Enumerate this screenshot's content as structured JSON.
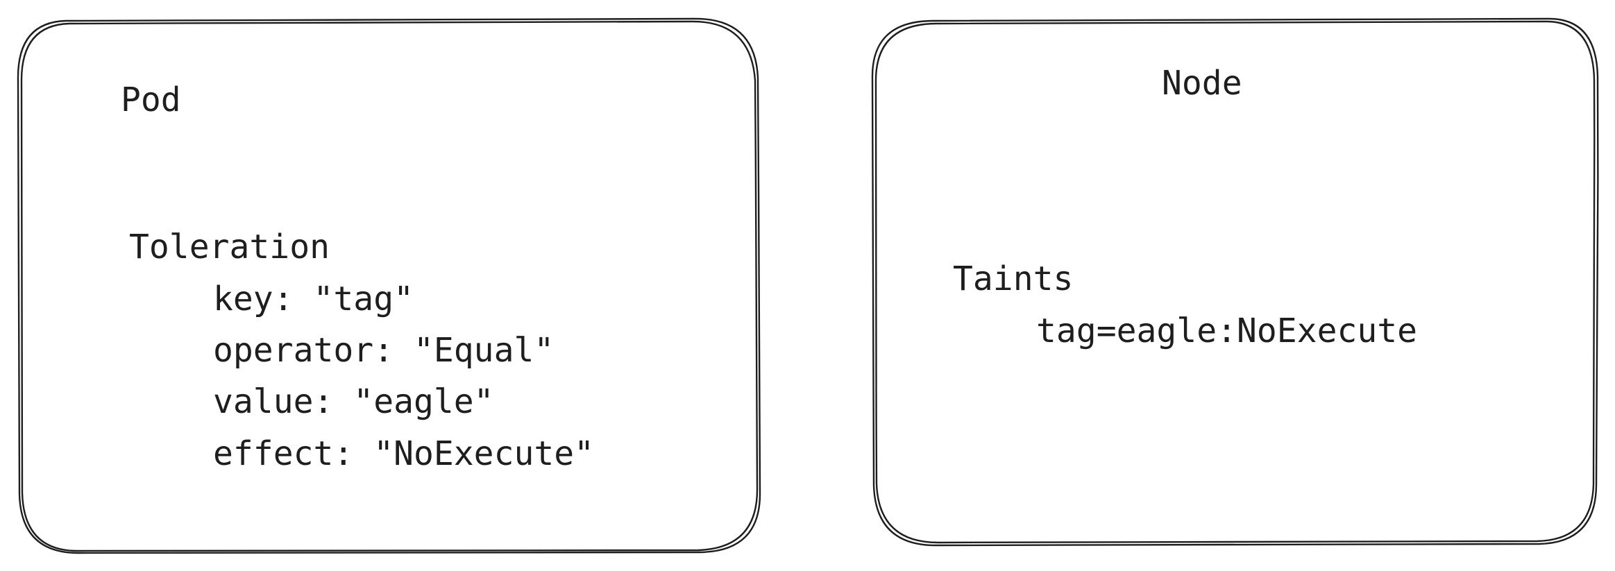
{
  "diagram": {
    "stroke_color": "#1e1e1e",
    "background_color": "#ffffff",
    "pod": {
      "title": "Pod",
      "toleration_heading": "Toleration",
      "fields": [
        "key: \"tag\"",
        "operator: \"Equal\"",
        "value: \"eagle\"",
        "effect: \"NoExecute\""
      ]
    },
    "node": {
      "title": "Node",
      "taints_heading": "Taints",
      "taints": [
        "tag=eagle:NoExecute"
      ]
    }
  }
}
